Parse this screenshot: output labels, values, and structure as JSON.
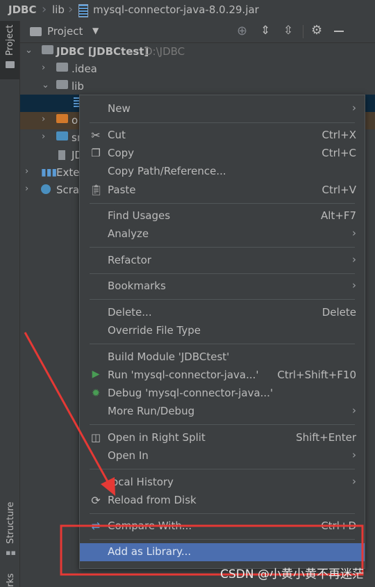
{
  "breadcrumb": {
    "project": "JDBC",
    "folder": "lib",
    "file": "mysql-connector-java-8.0.29.jar"
  },
  "left_strip": {
    "project_tab": "Project",
    "structure_tab": "Structure",
    "bookmarks_tab": "rks"
  },
  "panel": {
    "title": "Project"
  },
  "tree": {
    "root_name": "JDBC [JDBCtest]",
    "root_path": "D:\\JDBC",
    "idea": ".idea",
    "lib": "lib",
    "out_partial": "o",
    "src_partial": "sr",
    "iml_partial": "JD",
    "ext_partial": "Exter",
    "scratch_partial": "Scrat"
  },
  "menu": {
    "new": "New",
    "cut": "Cut",
    "cut_sc": "Ctrl+X",
    "copy": "Copy",
    "copy_sc": "Ctrl+C",
    "copy_path": "Copy Path/Reference...",
    "paste": "Paste",
    "paste_sc": "Ctrl+V",
    "find_usages": "Find Usages",
    "find_usages_sc": "Alt+F7",
    "analyze": "Analyze",
    "refactor": "Refactor",
    "bookmarks": "Bookmarks",
    "delete": "Delete...",
    "delete_sc": "Delete",
    "override": "Override File Type",
    "build_module": "Build Module 'JDBCtest'",
    "run": "Run 'mysql-connector-java...'",
    "run_sc": "Ctrl+Shift+F10",
    "debug": "Debug 'mysql-connector-java...'",
    "more_run": "More Run/Debug",
    "open_split": "Open in Right Split",
    "open_split_sc": "Shift+Enter",
    "open_in": "Open In",
    "local_history": "ocal History",
    "reload": "Reload from Disk",
    "compare": "Compare With...",
    "compare_sc": "Ctrl+D",
    "add_library": "Add as Library..."
  },
  "watermark": "CSDN @小黄小黄不再迷茫",
  "colors": {
    "accent_selected": "#4b6eaf",
    "annotation_red": "#e53935"
  }
}
